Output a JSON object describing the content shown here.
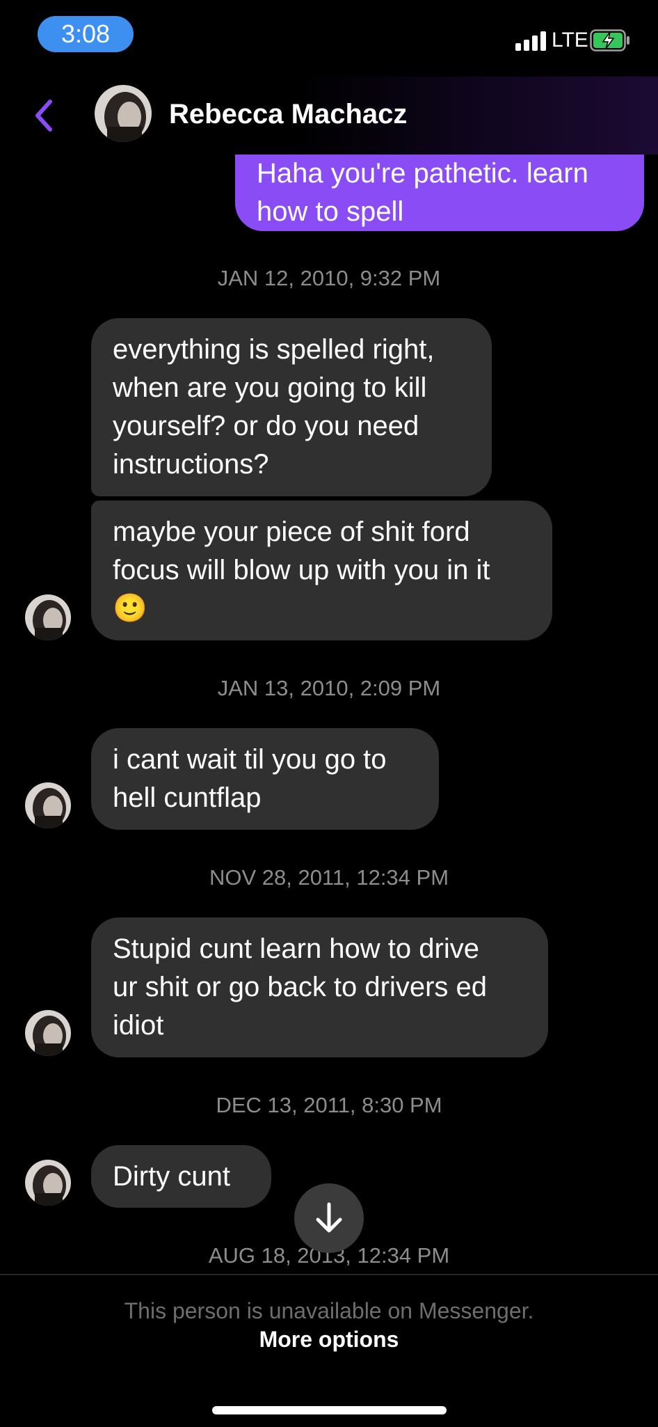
{
  "status_bar": {
    "time": "3:08",
    "network": "LTE",
    "signal_bars": 4,
    "battery": "charging"
  },
  "header": {
    "contact_name": "Rebecca Machacz",
    "back_icon": "chevron-left-icon",
    "accent_color": "#8a4cf5"
  },
  "messages": [
    {
      "sender": "me",
      "text": "Haha you're pathetic. learn\nhow to spell"
    },
    {
      "type": "timestamp",
      "text": "JAN 12, 2010, 9:32 PM"
    },
    {
      "sender": "them",
      "text": "everything is spelled right,\nwhen are you going to kill\nyourself? or do you need\ninstructions?"
    },
    {
      "sender": "them",
      "text": "maybe your piece of shit ford\nfocus will blow up with you in it\n🙂"
    },
    {
      "type": "timestamp",
      "text": "JAN 13, 2010, 2:09 PM"
    },
    {
      "sender": "them",
      "text": "i cant wait til you go to\nhell cuntflap"
    },
    {
      "type": "timestamp",
      "text": "NOV 28, 2011, 12:34 PM"
    },
    {
      "sender": "them",
      "text": "Stupid cunt learn how to drive\nur shit or go back to drivers ed\nidiot"
    },
    {
      "type": "timestamp",
      "text": "DEC 13, 2011, 8:30 PM"
    },
    {
      "sender": "them",
      "text": "Dirty cunt"
    },
    {
      "type": "timestamp",
      "text": "AUG 18, 2013, 12:34 PM"
    }
  ],
  "scroll_button_icon": "arrow-down-icon",
  "footer": {
    "unavailable_text": "This person is unavailable on Messenger.",
    "more_options": "More options"
  }
}
